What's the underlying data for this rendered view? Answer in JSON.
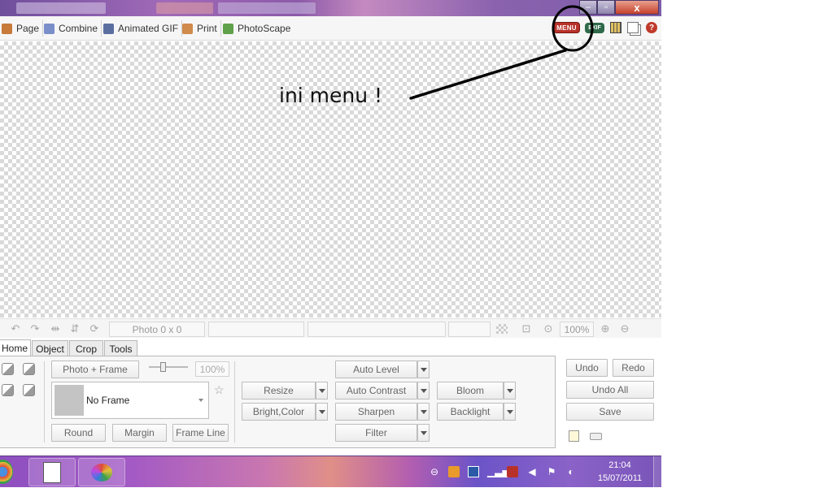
{
  "nav": {
    "items": [
      {
        "label": "Page",
        "icon": "page-icon"
      },
      {
        "label": "Combine",
        "icon": "combine-icon"
      },
      {
        "label": "Animated GIF",
        "icon": "animated-gif-icon"
      },
      {
        "label": "Print",
        "icon": "print-icon"
      },
      {
        "label": "PhotoScape",
        "icon": "photoscape-icon"
      }
    ]
  },
  "toolbar_right": {
    "menu_label": "MENU",
    "exif_label": "EXIF",
    "help_label": "?"
  },
  "window": {
    "close_label": "x",
    "min_label": "–",
    "max_label": "▫"
  },
  "annotation": {
    "text": "ini menu !"
  },
  "statusbar": {
    "photo_size": "Photo 0 x 0",
    "zoom": "100%"
  },
  "tabs": [
    {
      "label": "Home",
      "active": true
    },
    {
      "label": "Object",
      "active": false
    },
    {
      "label": "Crop",
      "active": false
    },
    {
      "label": "Tools",
      "active": false
    }
  ],
  "home": {
    "photo_frame_label": "Photo + Frame",
    "frame_zoom": "100%",
    "frame_selected": "No Frame",
    "round_label": "Round",
    "margin_label": "Margin",
    "frame_line_label": "Frame Line",
    "resize_label": "Resize",
    "bright_color_label": "Bright,Color",
    "auto_level_label": "Auto Level",
    "auto_contrast_label": "Auto Contrast",
    "sharpen_label": "Sharpen",
    "filter_label": "Filter",
    "bloom_label": "Bloom",
    "backlight_label": "Backlight"
  },
  "actions": {
    "undo_label": "Undo",
    "redo_label": "Redo",
    "undo_all_label": "Undo All",
    "save_label": "Save"
  },
  "taskbar": {
    "time": "21:04",
    "date": "15/07/2011"
  },
  "colors": {
    "menu_red": "#b8322a",
    "exif_green": "#2f6a4a",
    "taskbar_purple": "#8e4fc0"
  }
}
